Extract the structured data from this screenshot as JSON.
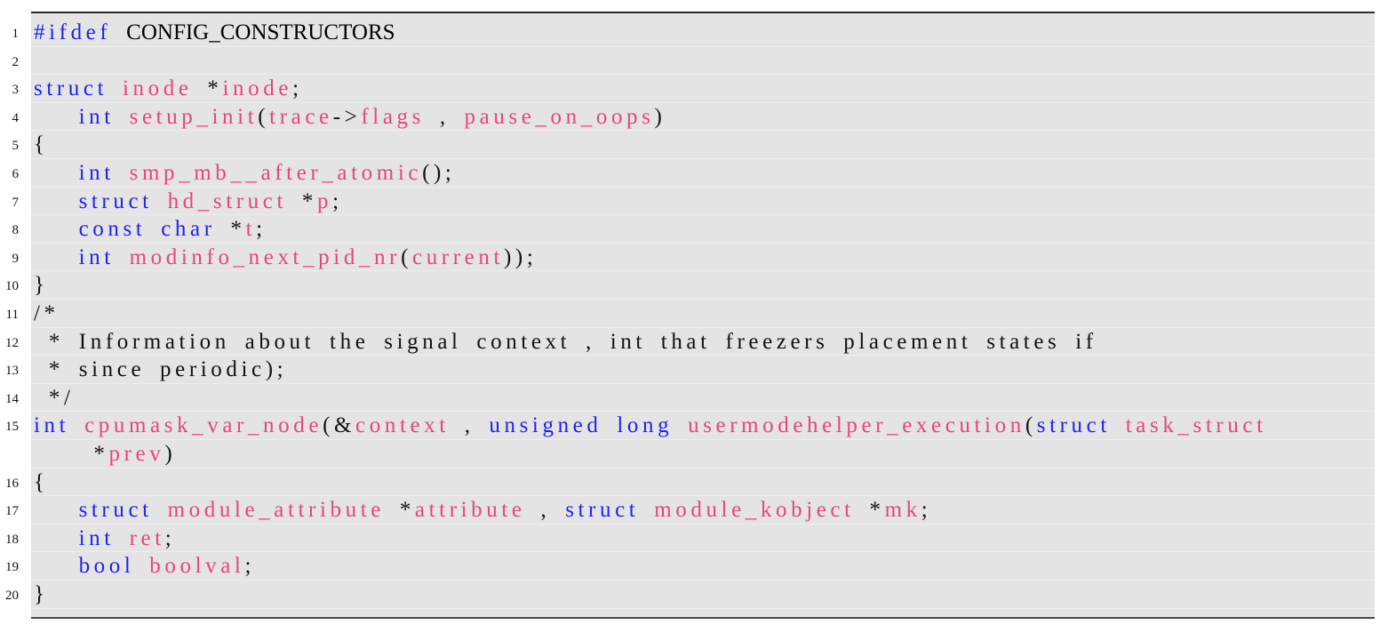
{
  "colors": {
    "keyword": "#1f1ff5",
    "identifier": "#e8447f",
    "text": "#111111",
    "background": "#e4e4e4"
  },
  "lines": [
    {
      "num": "1",
      "tokens": [
        [
          "#ifdef",
          "kw"
        ],
        [
          " ",
          "pl"
        ],
        [
          "CONFIG_CONSTRUCTORS",
          "rm"
        ]
      ]
    },
    {
      "num": "2",
      "tokens": []
    },
    {
      "num": "3",
      "tokens": [
        [
          "struct",
          "kw"
        ],
        [
          " ",
          "pl"
        ],
        [
          "inode",
          "id"
        ],
        [
          " *",
          "pl"
        ],
        [
          "inode",
          "id"
        ],
        [
          ";",
          "pl"
        ]
      ]
    },
    {
      "num": "4",
      "tokens": [
        [
          "   ",
          "pl"
        ],
        [
          "int",
          "kw"
        ],
        [
          " ",
          "pl"
        ],
        [
          "setup_init",
          "id"
        ],
        [
          "(",
          "pl"
        ],
        [
          "trace",
          "id"
        ],
        [
          "->",
          "pl"
        ],
        [
          "flags",
          "id"
        ],
        [
          " , ",
          "pl"
        ],
        [
          "pause_on_oops",
          "id"
        ],
        [
          ")",
          "pl"
        ]
      ]
    },
    {
      "num": "5",
      "tokens": [
        [
          "{",
          "pl"
        ]
      ]
    },
    {
      "num": "6",
      "tokens": [
        [
          "   ",
          "pl"
        ],
        [
          "int",
          "kw"
        ],
        [
          " ",
          "pl"
        ],
        [
          "smp_mb__after_atomic",
          "id"
        ],
        [
          "();",
          "pl"
        ]
      ]
    },
    {
      "num": "7",
      "tokens": [
        [
          "   ",
          "pl"
        ],
        [
          "struct",
          "kw"
        ],
        [
          " ",
          "pl"
        ],
        [
          "hd_struct",
          "id"
        ],
        [
          " *",
          "pl"
        ],
        [
          "p",
          "id"
        ],
        [
          ";",
          "pl"
        ]
      ]
    },
    {
      "num": "8",
      "tokens": [
        [
          "   ",
          "pl"
        ],
        [
          "const",
          "kw"
        ],
        [
          " ",
          "pl"
        ],
        [
          "char",
          "kw"
        ],
        [
          " *",
          "pl"
        ],
        [
          "t",
          "id"
        ],
        [
          ";",
          "pl"
        ]
      ]
    },
    {
      "num": "9",
      "tokens": [
        [
          "   ",
          "pl"
        ],
        [
          "int",
          "kw"
        ],
        [
          " ",
          "pl"
        ],
        [
          "modinfo_next_pid_nr",
          "id"
        ],
        [
          "(",
          "pl"
        ],
        [
          "current",
          "id"
        ],
        [
          "));",
          "pl"
        ]
      ]
    },
    {
      "num": "10",
      "tokens": [
        [
          "}",
          "pl"
        ]
      ]
    },
    {
      "num": "11",
      "tokens": [
        [
          "/*",
          "pl"
        ]
      ]
    },
    {
      "num": "12",
      "tokens": [
        [
          " * Information about the signal context , int that freezers placement states if",
          "pl"
        ]
      ]
    },
    {
      "num": "13",
      "tokens": [
        [
          " * since periodic);",
          "pl"
        ]
      ]
    },
    {
      "num": "14",
      "tokens": [
        [
          " */",
          "pl"
        ]
      ]
    },
    {
      "num": "15",
      "tokens": [
        [
          "int",
          "kw"
        ],
        [
          " ",
          "pl"
        ],
        [
          "cpumask_var_node",
          "id"
        ],
        [
          "(&",
          "pl"
        ],
        [
          "context",
          "id"
        ],
        [
          " , ",
          "pl"
        ],
        [
          "unsigned",
          "kw"
        ],
        [
          " ",
          "pl"
        ],
        [
          "long",
          "kw"
        ],
        [
          " ",
          "pl"
        ],
        [
          "usermodehelper_execution",
          "id"
        ],
        [
          "(",
          "pl"
        ],
        [
          "struct",
          "kw"
        ],
        [
          " ",
          "pl"
        ],
        [
          "task_struct",
          "id"
        ]
      ]
    },
    {
      "num": "",
      "tokens": [
        [
          "    *",
          "pl"
        ],
        [
          "prev",
          "id"
        ],
        [
          ")",
          "pl"
        ]
      ]
    },
    {
      "num": "16",
      "tokens": [
        [
          "{",
          "pl"
        ]
      ]
    },
    {
      "num": "17",
      "tokens": [
        [
          "   ",
          "pl"
        ],
        [
          "struct",
          "kw"
        ],
        [
          " ",
          "pl"
        ],
        [
          "module_attribute",
          "id"
        ],
        [
          " *",
          "pl"
        ],
        [
          "attribute",
          "id"
        ],
        [
          " , ",
          "pl"
        ],
        [
          "struct",
          "kw"
        ],
        [
          " ",
          "pl"
        ],
        [
          "module_kobject",
          "id"
        ],
        [
          " *",
          "pl"
        ],
        [
          "mk",
          "id"
        ],
        [
          ";",
          "pl"
        ]
      ]
    },
    {
      "num": "18",
      "tokens": [
        [
          "   ",
          "pl"
        ],
        [
          "int",
          "kw"
        ],
        [
          " ",
          "pl"
        ],
        [
          "ret",
          "id"
        ],
        [
          ";",
          "pl"
        ]
      ]
    },
    {
      "num": "19",
      "tokens": [
        [
          "   ",
          "pl"
        ],
        [
          "bool",
          "kw"
        ],
        [
          " ",
          "pl"
        ],
        [
          "boolval",
          "id"
        ],
        [
          ";",
          "pl"
        ]
      ]
    },
    {
      "num": "20",
      "tokens": [
        [
          "}",
          "pl"
        ]
      ]
    }
  ]
}
